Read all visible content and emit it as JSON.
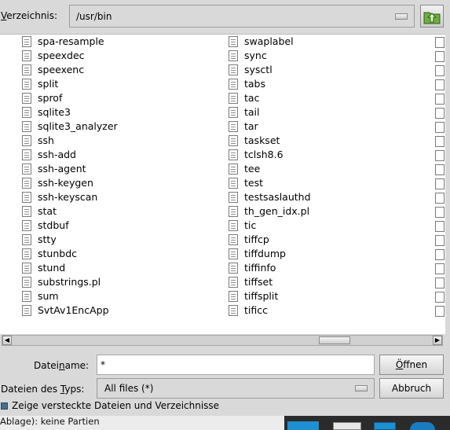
{
  "directory": {
    "label": "Verzeichnis:",
    "label_mnemonic": "V",
    "label_rest": "erzeichnis:",
    "path": "/usr/bin"
  },
  "icons": {
    "up_button": "folder-up-icon",
    "file": "file-icon"
  },
  "files": {
    "column1": [
      "spa-resample",
      "speexdec",
      "speexenc",
      "split",
      "sprof",
      "sqlite3",
      "sqlite3_analyzer",
      "ssh",
      "ssh-add",
      "ssh-agent",
      "ssh-keygen",
      "ssh-keyscan",
      "stat",
      "stdbuf",
      "stty",
      "stunbdc",
      "stund",
      "substrings.pl",
      "sum",
      "SvtAv1EncApp"
    ],
    "column2": [
      "swaplabel",
      "sync",
      "sysctl",
      "tabs",
      "tac",
      "tail",
      "tar",
      "taskset",
      "tclsh8.6",
      "tee",
      "test",
      "testsaslauthd",
      "th_gen_idx.pl",
      "tic",
      "tiffcp",
      "tiffdump",
      "tiffinfo",
      "tiffset",
      "tiffsplit",
      "tificc"
    ]
  },
  "scrollbar": {
    "position_fraction": 0.79
  },
  "filename": {
    "label_pre": "Datei",
    "label_mn": "n",
    "label_post": "ame:",
    "value": "*"
  },
  "filetype": {
    "label_pre": "Dateien des ",
    "label_mn": "T",
    "label_post": "yps:",
    "value": "All files (*)"
  },
  "buttons": {
    "open_mn": "Ö",
    "open_rest": "ffnen",
    "cancel": "Abbruch"
  },
  "hidden_files": {
    "label": "Zeige versteckte Dateien und Verzeichnisse",
    "checked": true
  },
  "background_window": {
    "status_text": "Ablage):  keine Partien"
  },
  "colors": {
    "dialog_bg": "#d9d9d9",
    "list_bg": "#ffffff",
    "taskbar_bg": "#2b2b2b",
    "accent_blue": "#1e8fd0"
  }
}
